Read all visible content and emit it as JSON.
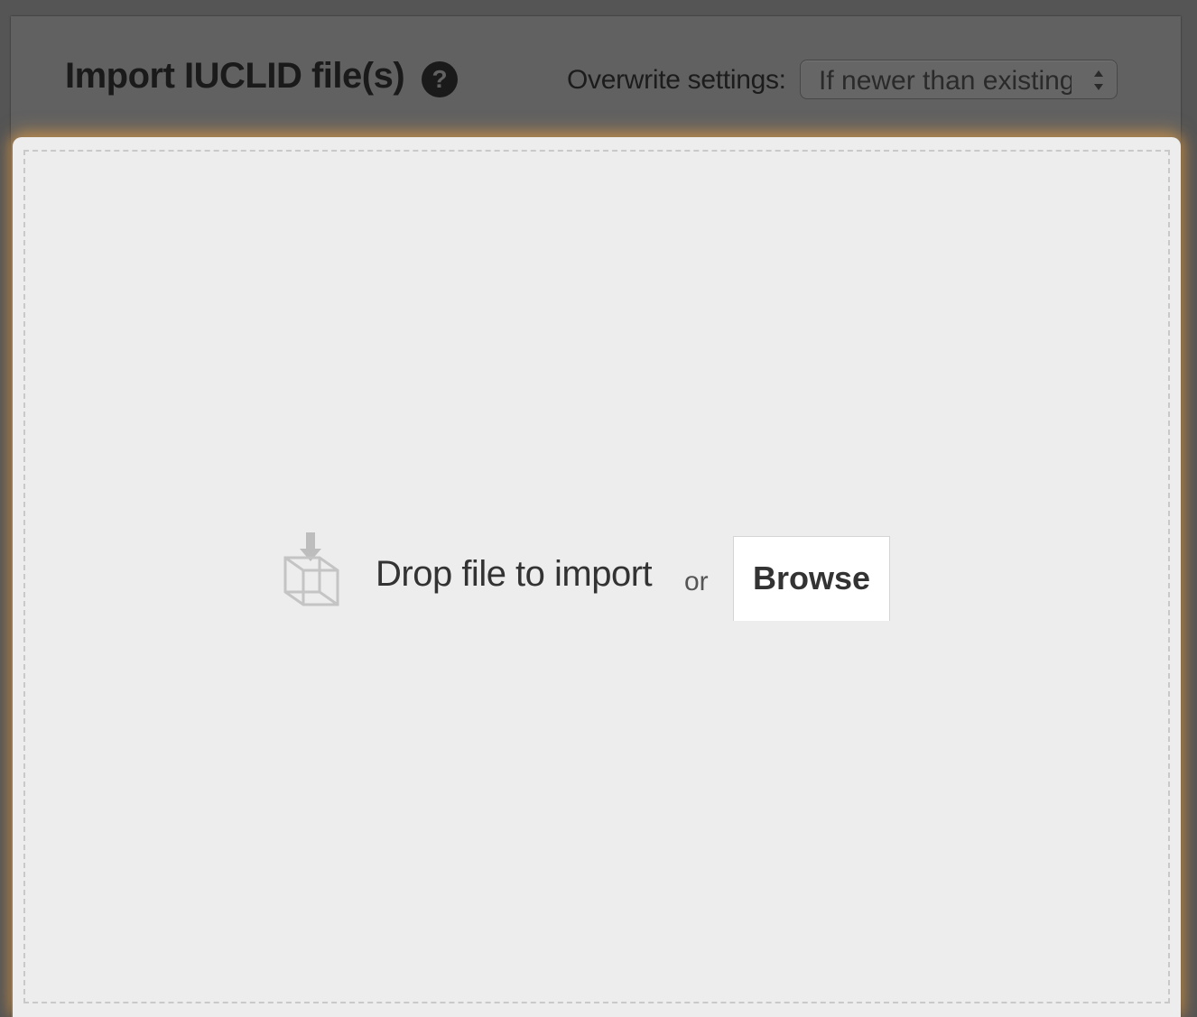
{
  "dialog": {
    "title": "Import IUCLID file(s)",
    "help_icon": "question-circle-icon",
    "help_glyph": "?"
  },
  "overwrite": {
    "label": "Overwrite settings:",
    "selected_value": "If newer than existing",
    "arrows_icon": "select-arrows-icon"
  },
  "dropzone": {
    "icon": "box-download-icon",
    "drop_text": "Drop file to import",
    "or_text": "or",
    "browse_label": "Browse"
  },
  "colors": {
    "overlay": "#555555",
    "header_bg": "#616161",
    "dropzone_bg": "#ededed",
    "glow": "#c8964f"
  }
}
